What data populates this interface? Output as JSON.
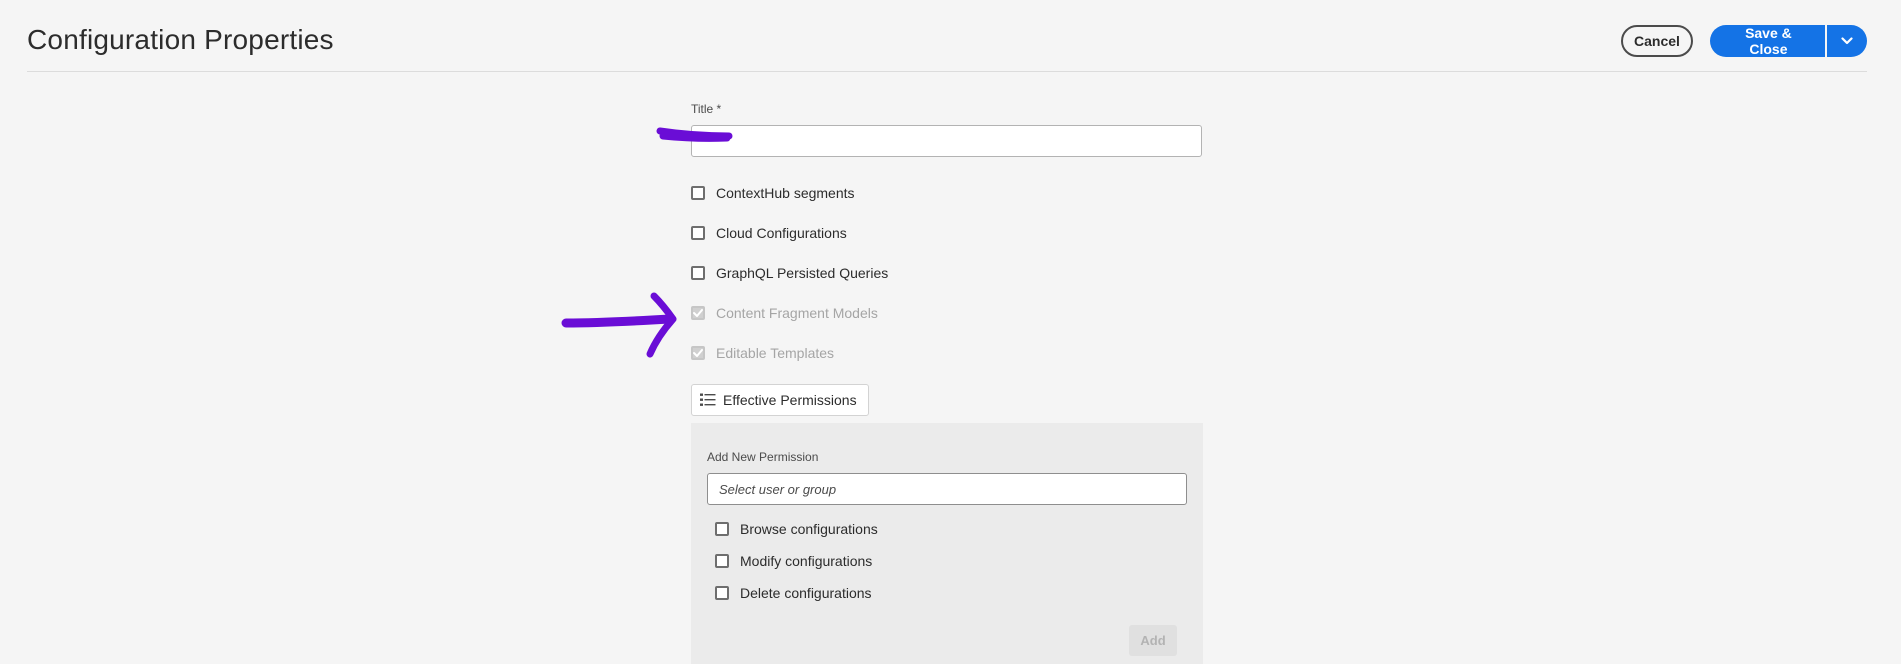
{
  "header": {
    "title": "Configuration Properties",
    "cancel_label": "Cancel",
    "save_label": "Save & Close"
  },
  "form": {
    "title_label": "Title *",
    "title_value": "",
    "options": [
      {
        "label": "ContextHub segments",
        "checked": false,
        "disabled": false
      },
      {
        "label": "Cloud Configurations",
        "checked": false,
        "disabled": false
      },
      {
        "label": "GraphQL Persisted Queries",
        "checked": false,
        "disabled": false
      },
      {
        "label": "Content Fragment Models",
        "checked": true,
        "disabled": true
      },
      {
        "label": "Editable Templates",
        "checked": true,
        "disabled": true
      }
    ],
    "effective_permissions_label": "Effective Permissions"
  },
  "permissions_panel": {
    "label": "Add New Permission",
    "user_placeholder": "Select user or group",
    "options": [
      {
        "label": "Browse configurations",
        "checked": false
      },
      {
        "label": "Modify configurations",
        "checked": false
      },
      {
        "label": "Delete configurations",
        "checked": false
      }
    ],
    "add_label": "Add"
  },
  "colors": {
    "accent": "#1473e6",
    "annotation": "#6a0dd6",
    "background": "#f5f5f5"
  }
}
